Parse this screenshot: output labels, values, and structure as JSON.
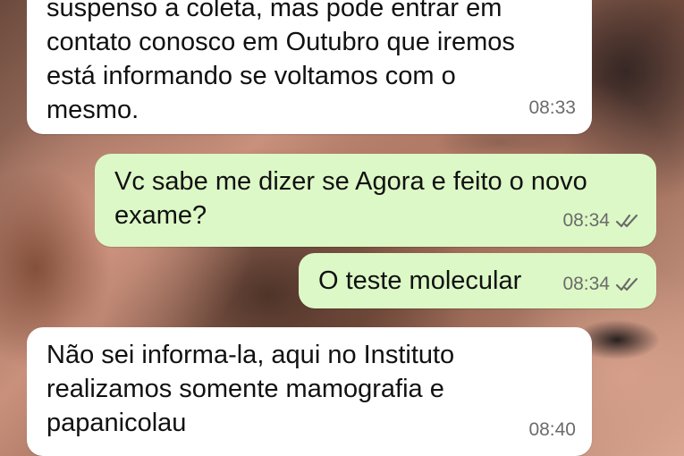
{
  "chat": {
    "messages": [
      {
        "direction": "incoming",
        "text": "suspenso a coleta, mas pode entrar em\ncontato conosco em Outubro que iremos\nestá informando se voltamos com o\nmesmo.",
        "time": "08:33"
      },
      {
        "direction": "outgoing",
        "text": "Vc sabe me dizer se Agora e feito o novo\nexame?",
        "time": "08:34",
        "status_icon": "double-check-icon"
      },
      {
        "direction": "outgoing",
        "text": "O teste molecular",
        "time": "08:34",
        "status_icon": "double-check-icon"
      },
      {
        "direction": "incoming",
        "text": "Não sei informa-la, aqui no Instituto\nrealizamos somente mamografia e\npapanicolau",
        "time": "08:40"
      }
    ]
  },
  "colors": {
    "incoming_bubble": "#ffffff",
    "outgoing_bubble": "#dcf8c6",
    "time_text": "#6b6b6b",
    "ticks": "#6b6b6b"
  }
}
